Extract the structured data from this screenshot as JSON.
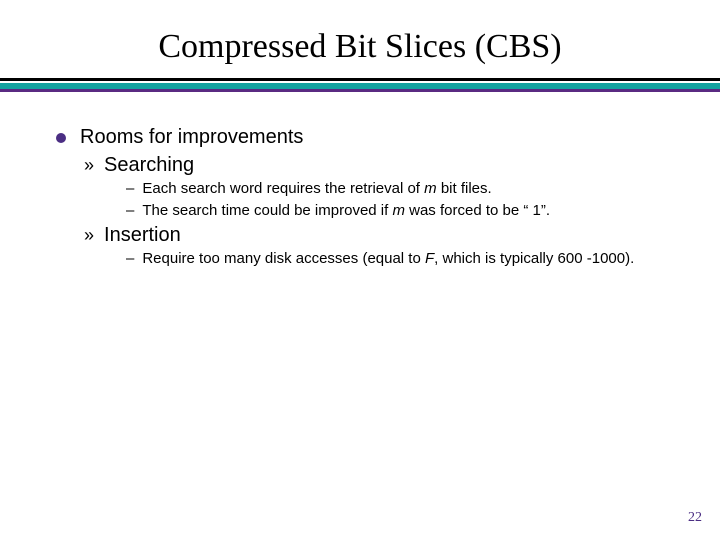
{
  "title": "Compressed Bit Slices (CBS)",
  "bullets": {
    "main": "Rooms for improvements",
    "sub1": {
      "label": "Searching",
      "d1_pre": "Each search word requires the retrieval of ",
      "d1_m": "m",
      "d1_post": " bit files.",
      "d2_pre": "The search time could be improved if ",
      "d2_m": "m",
      "d2_post": " was forced to be “ 1”."
    },
    "sub2": {
      "label": "Insertion",
      "d1_pre": "Require too many disk accesses (equal to ",
      "d1_F": "F",
      "d1_post": ", which is typically 600 -1000)."
    }
  },
  "markers": {
    "raquo": "»",
    "dash": "–"
  },
  "pagenum": "22"
}
